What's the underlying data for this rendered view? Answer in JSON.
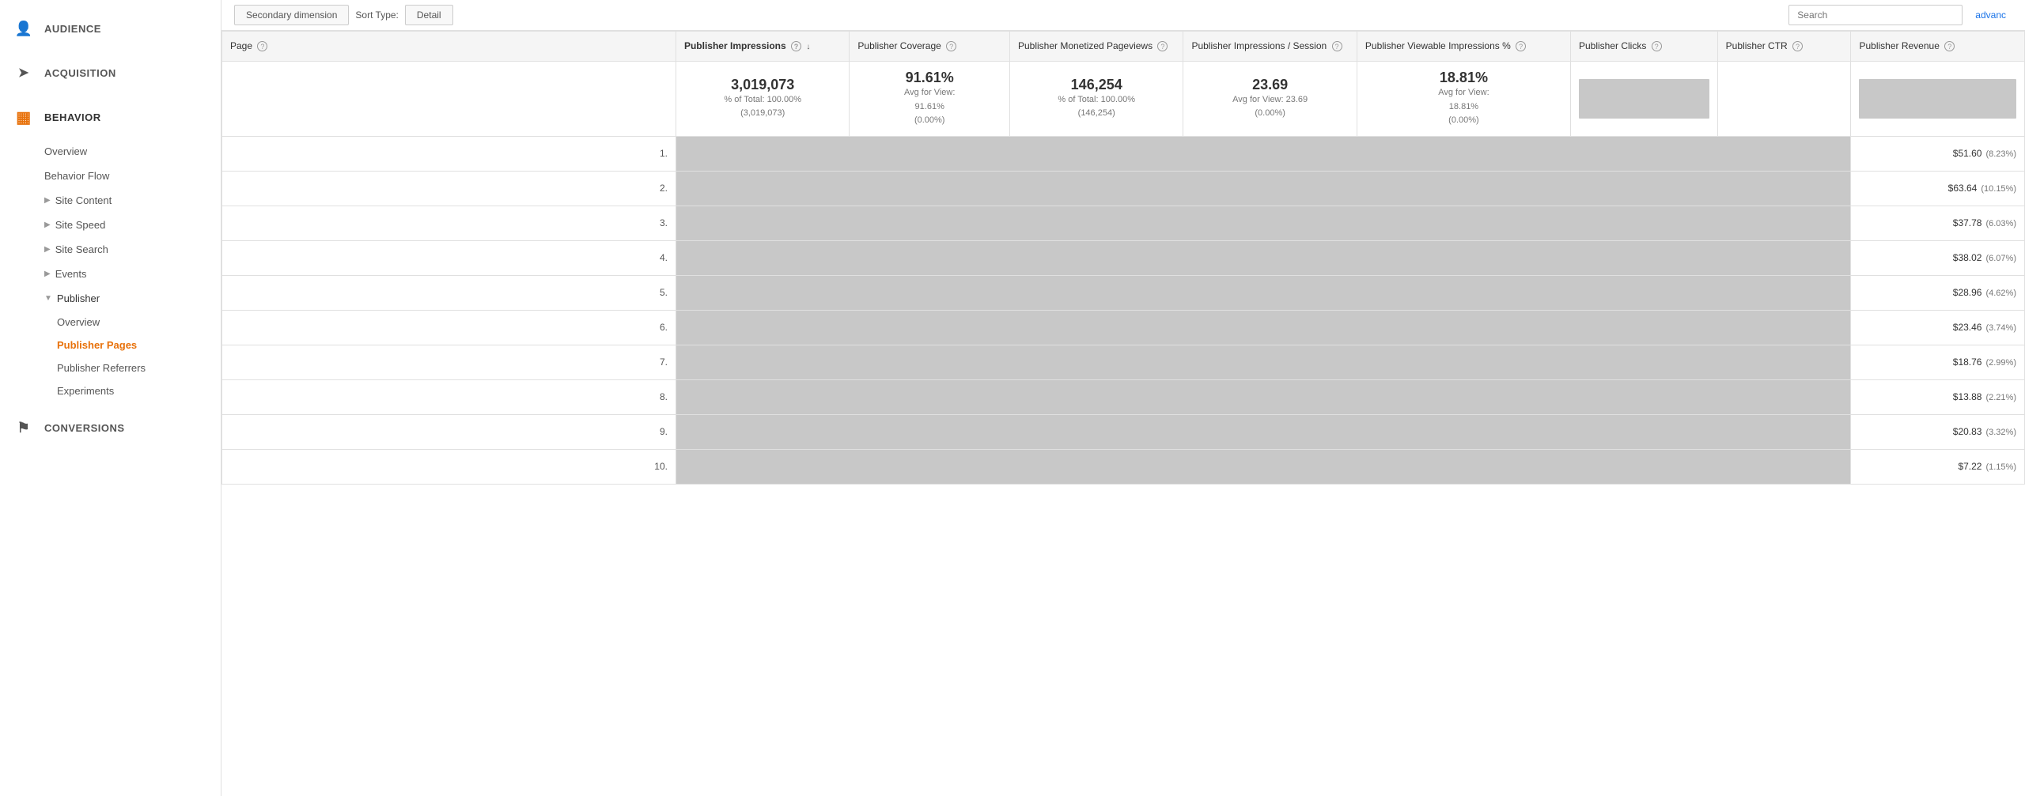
{
  "sidebar": {
    "sections": [
      {
        "id": "audience",
        "label": "AUDIENCE",
        "icon": "👤",
        "active": false
      },
      {
        "id": "acquisition",
        "label": "ACQUISITION",
        "icon": "➤",
        "active": false
      },
      {
        "id": "behavior",
        "label": "BEHAVIOR",
        "icon": "▦",
        "active": true
      }
    ],
    "behavior_items": [
      {
        "id": "overview",
        "label": "Overview",
        "active": false,
        "indent": false
      },
      {
        "id": "behavior-flow",
        "label": "Behavior Flow",
        "active": false,
        "indent": false
      },
      {
        "id": "site-content",
        "label": "Site Content",
        "active": false,
        "expandable": true
      },
      {
        "id": "site-speed",
        "label": "Site Speed",
        "active": false,
        "expandable": true
      },
      {
        "id": "site-search",
        "label": "Site Search",
        "active": false,
        "expandable": true
      },
      {
        "id": "events",
        "label": "Events",
        "active": false,
        "expandable": true
      },
      {
        "id": "publisher",
        "label": "Publisher",
        "active": true,
        "expandable": true,
        "expanded": true
      }
    ],
    "publisher_children": [
      {
        "id": "pub-overview",
        "label": "Overview",
        "active": false
      },
      {
        "id": "pub-pages",
        "label": "Publisher Pages",
        "active": true
      },
      {
        "id": "pub-referrers",
        "label": "Publisher Referrers",
        "active": false
      },
      {
        "id": "experiments",
        "label": "Experiments",
        "active": false
      }
    ],
    "conversions": {
      "label": "CONVERSIONS",
      "icon": "⚑"
    }
  },
  "toolbar": {
    "secondary_dim_label": "Secondary dimension",
    "sort_type_label": "Sort Type:",
    "detail_label": "Detail",
    "adv_label": "advanc"
  },
  "table": {
    "columns": [
      {
        "id": "page",
        "label": "Page",
        "class": "page-col",
        "sorted": false,
        "help": true
      },
      {
        "id": "impressions",
        "label": "Publisher Impressions",
        "class": "imp-col",
        "sorted": true,
        "sort_dir": "↓",
        "help": true
      },
      {
        "id": "coverage",
        "label": "Publisher Coverage",
        "class": "cov-col",
        "sorted": false,
        "help": true
      },
      {
        "id": "monetized",
        "label": "Publisher Monetized Pageviews",
        "class": "mon-col",
        "sorted": false,
        "help": true
      },
      {
        "id": "session",
        "label": "Publisher Impressions / Session",
        "class": "sess-col",
        "sorted": false,
        "help": true
      },
      {
        "id": "viewable",
        "label": "Publisher Viewable Impressions %",
        "class": "view-col",
        "sorted": false,
        "help": true
      },
      {
        "id": "clicks",
        "label": "Publisher Clicks",
        "class": "clicks-col",
        "sorted": false,
        "help": true
      },
      {
        "id": "ctr",
        "label": "Publisher CTR",
        "class": "ctr-col",
        "sorted": false,
        "help": true
      },
      {
        "id": "revenue",
        "label": "Publisher Revenue",
        "class": "rev-col",
        "sorted": false,
        "help": true
      }
    ],
    "summary": {
      "impressions_val": "3,019,073",
      "impressions_sub": "% of Total: 100.00%\n(3,019,073)",
      "coverage_val": "91.61%",
      "coverage_sub": "Avg for View:\n91.61%\n(0.00%)",
      "monetized_val": "146,254",
      "monetized_sub": "% of Total: 100.00%\n(146,254)",
      "session_val": "23.69",
      "session_sub": "Avg for View: 23.69\n(0.00%)",
      "viewable_val": "18.81%",
      "viewable_sub": "Avg for View:\n18.81%\n(0.00%)"
    },
    "rows": [
      {
        "num": 1,
        "revenue": "$51.60",
        "pct": "(8.23%)"
      },
      {
        "num": 2,
        "revenue": "$63.64",
        "pct": "(10.15%)"
      },
      {
        "num": 3,
        "revenue": "$37.78",
        "pct": "(6.03%)"
      },
      {
        "num": 4,
        "revenue": "$38.02",
        "pct": "(6.07%)"
      },
      {
        "num": 5,
        "revenue": "$28.96",
        "pct": "(4.62%)"
      },
      {
        "num": 6,
        "revenue": "$23.46",
        "pct": "(3.74%)"
      },
      {
        "num": 7,
        "revenue": "$18.76",
        "pct": "(2.99%)"
      },
      {
        "num": 8,
        "revenue": "$13.88",
        "pct": "(2.21%)"
      },
      {
        "num": 9,
        "revenue": "$20.83",
        "pct": "(3.32%)"
      },
      {
        "num": 10,
        "revenue": "$7.22",
        "pct": "(1.15%)"
      }
    ]
  }
}
